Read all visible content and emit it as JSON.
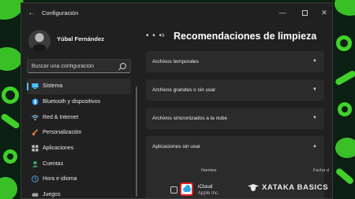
{
  "window": {
    "title": "Configuración",
    "controls": {
      "minimize": "—",
      "close": "✕"
    }
  },
  "user": {
    "name": "Yúbal Fernández"
  },
  "search": {
    "placeholder": "Buscar una configuración"
  },
  "sidebar": {
    "items": [
      {
        "label": "Sistema",
        "icon": "monitor-icon",
        "active": true
      },
      {
        "label": "Bluetooth y dispositivos",
        "icon": "bluetooth-icon"
      },
      {
        "label": "Red & Internet",
        "icon": "wifi-icon"
      },
      {
        "label": "Personalización",
        "icon": "brush-icon"
      },
      {
        "label": "Aplicaciones",
        "icon": "apps-icon"
      },
      {
        "label": "Cuentas",
        "icon": "person-icon"
      },
      {
        "label": "Hora e idioma",
        "icon": "globe-clock-icon"
      },
      {
        "label": "Juegos",
        "icon": "gamepad-icon"
      }
    ]
  },
  "main": {
    "breadcrumb_ellipsis": "• • •",
    "breadcrumb_separator": "›",
    "title": "Recomendaciones de limpieza",
    "sections": [
      {
        "label": "Archivos temporales",
        "expanded": false
      },
      {
        "label": "Archivos grandes o sin usar",
        "expanded": false
      },
      {
        "label": "Archivos sincronizados a la nube",
        "expanded": false
      },
      {
        "label": "Aplicaciones sin usar",
        "expanded": true
      }
    ],
    "table": {
      "columns": [
        "Nombre",
        "Fecha d"
      ],
      "rows": [
        {
          "name": "iCloud",
          "publisher": "Apple Inc.",
          "checked": false
        }
      ]
    }
  },
  "watermark": {
    "text": "XATAKA BASICS"
  },
  "colors": {
    "accent": "#4cc2ff",
    "window_bg": "#202020",
    "card_bg": "#2b2b2b",
    "wallpaper_green": "#3fd12a",
    "highlight_red": "#e02020"
  }
}
